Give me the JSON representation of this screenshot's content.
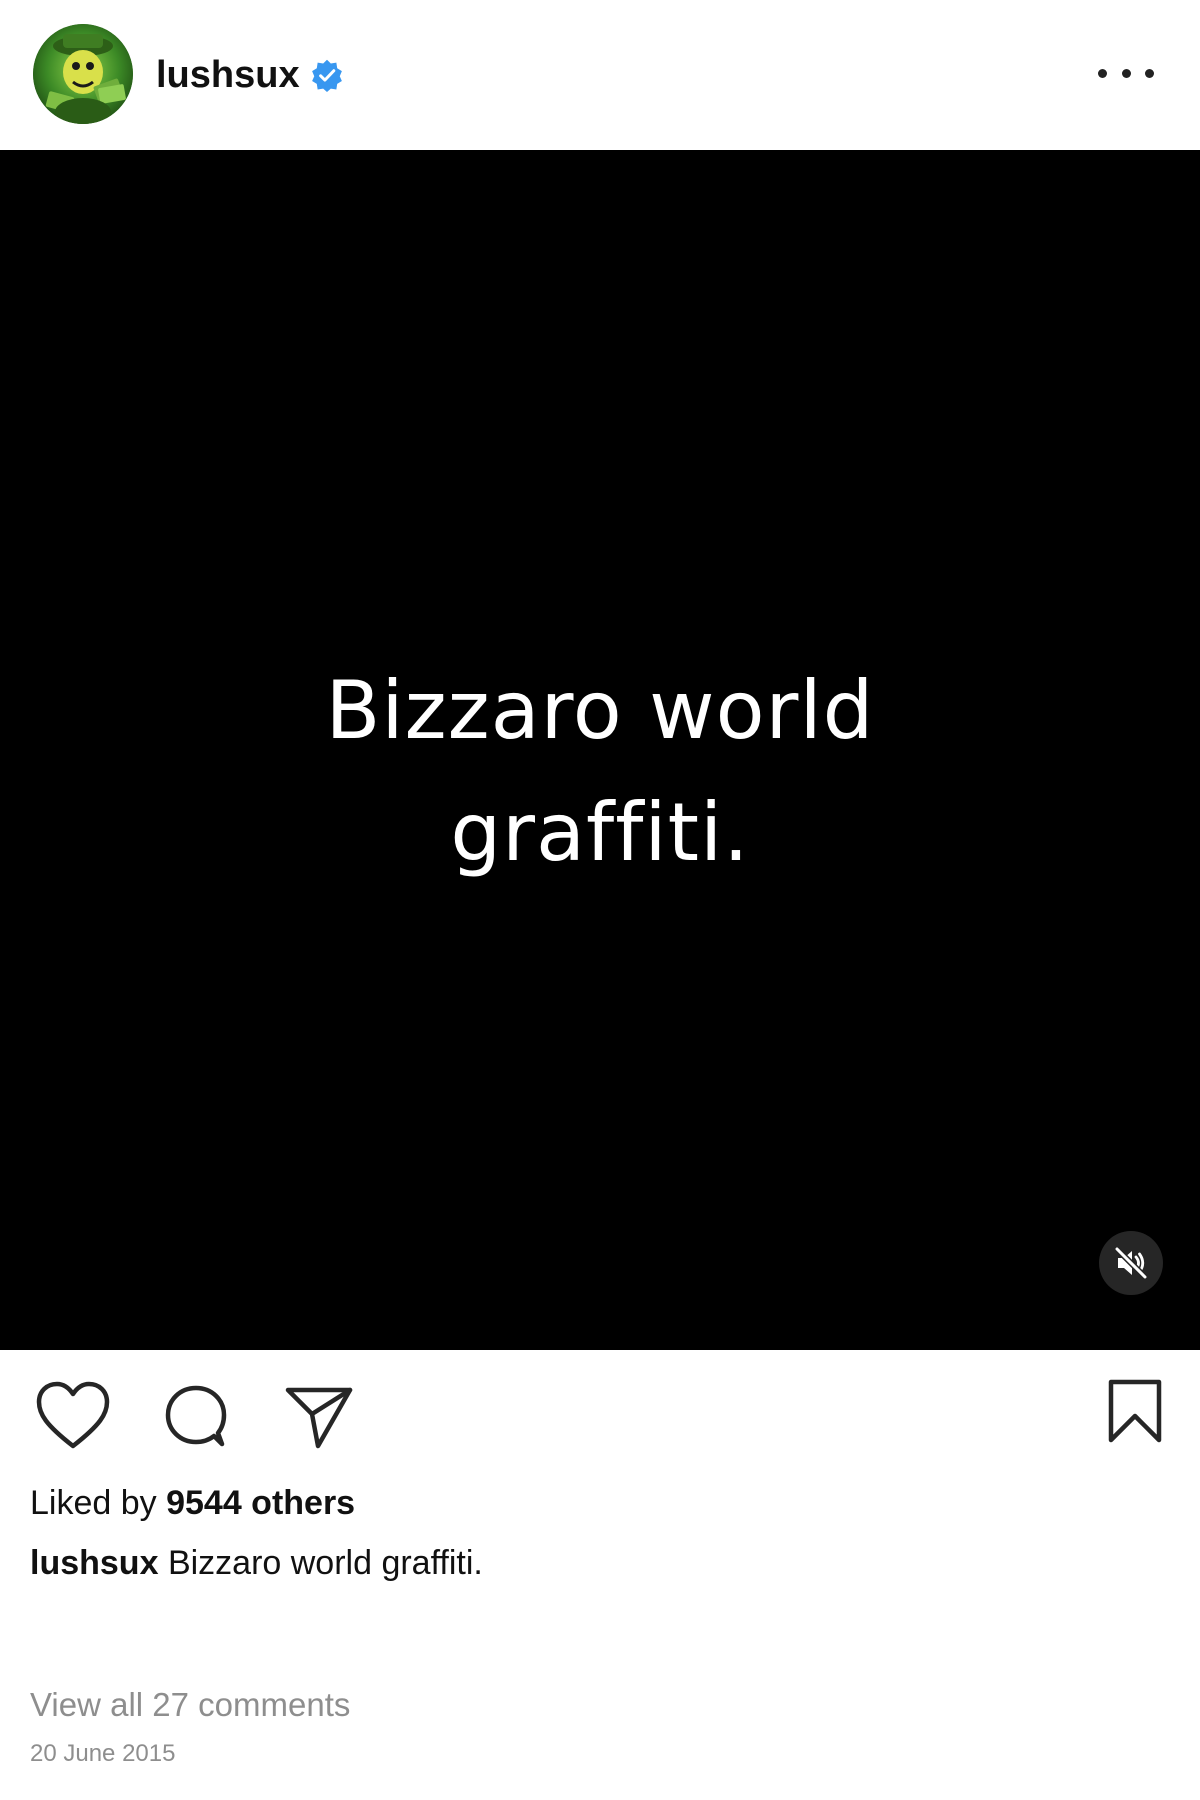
{
  "header": {
    "username": "lushsux",
    "verified_icon": "verified-badge-icon",
    "more_icon": "more-options-icon"
  },
  "media": {
    "caption_lines": [
      "Bizzaro world",
      "graffiti."
    ],
    "mute_icon": "muted-speaker-icon"
  },
  "actions": {
    "like_icon": "heart-icon",
    "comment_icon": "comment-bubble-icon",
    "share_icon": "paper-plane-icon",
    "save_icon": "bookmark-icon"
  },
  "likes": {
    "prefix": "Liked by",
    "count_text": "9544 others"
  },
  "caption": {
    "username": "lushsux",
    "text": "Bizzaro world graffiti."
  },
  "comments_link": "View all 27 comments",
  "date": "20 June 2015",
  "colors": {
    "verified_blue": "#3897f0",
    "media_background": "#000000",
    "muted_text": "#8e8e8e"
  }
}
